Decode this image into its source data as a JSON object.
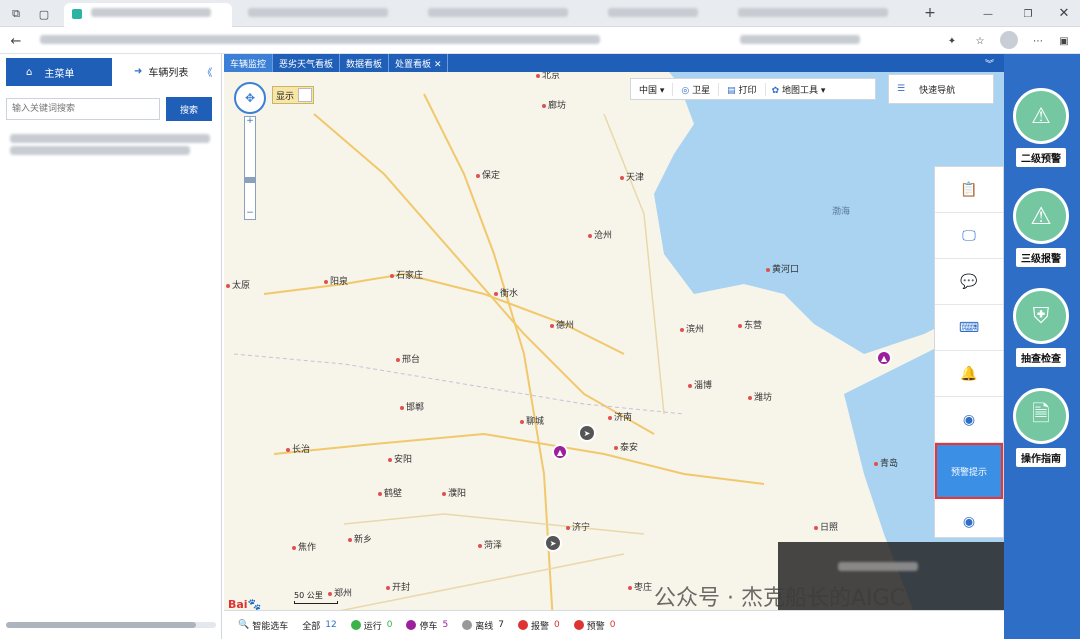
{
  "browser": {
    "tab_active_label": "",
    "new_tab": "+"
  },
  "left": {
    "main_menu": "主菜单",
    "vehicle_list": "车辆列表",
    "search_placeholder": "输入关键词搜索",
    "search_button": "搜索"
  },
  "tabs": [
    {
      "label": "车辆监控"
    },
    {
      "label": "恶劣天气看板"
    },
    {
      "label": "数据看板"
    },
    {
      "label": "处置看板"
    }
  ],
  "map": {
    "display_toggle": "显示",
    "toolbar": {
      "region": "中国",
      "satellite": "卫星",
      "print": "打印",
      "map_tools": "地图工具",
      "quick_nav": "快速导航"
    },
    "scale": "50 公里",
    "sea_label": "渤海",
    "cities": [
      "北京",
      "廊坊",
      "天津",
      "保定",
      "沧州",
      "石家庄",
      "太原",
      "阳泉",
      "衡水",
      "德州",
      "邢台",
      "滨州",
      "东营",
      "邯郸",
      "济南",
      "淄博",
      "潍坊",
      "聊城",
      "泰安",
      "长治",
      "安阳",
      "鹤壁",
      "濮阳",
      "济宁",
      "焦作",
      "新乡",
      "菏泽",
      "开封",
      "郑州",
      "枣庄",
      "日照",
      "青岛",
      "黄河口"
    ]
  },
  "float_panel": {
    "highlight_label": "预警提示"
  },
  "right_panel": {
    "buttons": [
      {
        "label": "二级预警"
      },
      {
        "label": "三级报警"
      },
      {
        "label": "抽查检查"
      },
      {
        "label": "操作指南"
      }
    ]
  },
  "status_bar": {
    "smart_select": "智能选车",
    "all_label": "全部",
    "all_count": "12",
    "running_label": "运行",
    "running_count": "0",
    "parked_label": "停车",
    "parked_count": "5",
    "offline_label": "离线",
    "offline_count": "7",
    "alarm_label": "报警",
    "alarm_count": "0",
    "warning_label": "预警",
    "warning_count": "0"
  },
  "watermark": "公众号 · 杰克船长的AIGC"
}
